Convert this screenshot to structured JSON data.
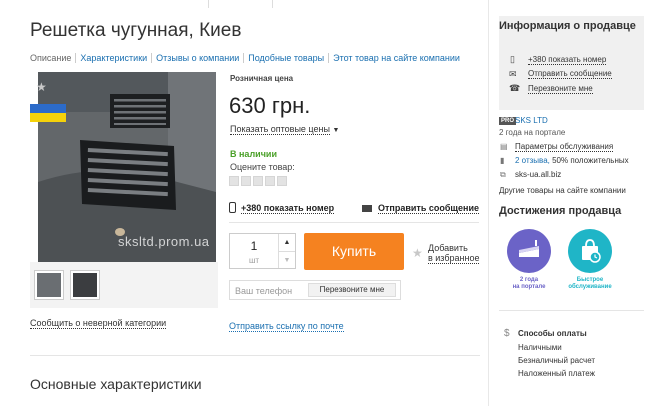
{
  "title": "Решетка чугунная, Киев",
  "tabs": {
    "description": "Описание",
    "characteristics": "Характеристики",
    "reviews": "Отзывы о компании",
    "similar": "Подобные товары",
    "on_site": "Этот товар на сайте компании"
  },
  "photo": {
    "watermark": "sksltd.prom.ua",
    "report_link": "Сообщить о неверной категории"
  },
  "product": {
    "retail_label": "Розничная цена",
    "price": "630 грн.",
    "wholesale_link": "Показать оптовые цены",
    "stock": "В наличии",
    "rate_label": "Оцените товар:",
    "rating_stars_total": 5,
    "phone_link": "+380 показать номер",
    "message_link": "Отправить сообщение",
    "quantity": "1",
    "unit": "шт",
    "buy_label": "Купить",
    "favorite_line1": "Добавить",
    "favorite_line2": "в избранное",
    "phone_placeholder": "Ваш телефон",
    "callback_label": "Перезвоните мне",
    "send_link": "Отправить ссылку по почте"
  },
  "main_characteristics": "Основные характеристики",
  "seller": {
    "heading": "Информация о продавце",
    "phone": "+380 показать номер",
    "message": "Отправить сообщение",
    "callback": "Перезвоните мне",
    "pro_badge": "PRO",
    "company": "SKS LTD",
    "years": "2 года на портале",
    "service_params": "Параметры обслуживания",
    "reviews_link": "2 отзыва,",
    "reviews_rest": " 50% положительных",
    "site": "sks-ua.all.biz",
    "other_goods": "Другие товары на сайте компании"
  },
  "achievements": {
    "heading": "Достижения продавца",
    "badge1_line1": "2 года",
    "badge1_line2": "на портале",
    "badge2_line1": "Быстрое",
    "badge2_line2": "обслуживание"
  },
  "payment": {
    "title": "Способы оплаты",
    "items": [
      "Наличными",
      "Безналичный расчет",
      "Наложенный платеж"
    ]
  },
  "colors": {
    "buy_button": "#f58220",
    "link": "#1a6fb0",
    "in_stock": "#4aa028",
    "badge_purple": "#6b63c7",
    "badge_teal": "#1fb5c7"
  }
}
